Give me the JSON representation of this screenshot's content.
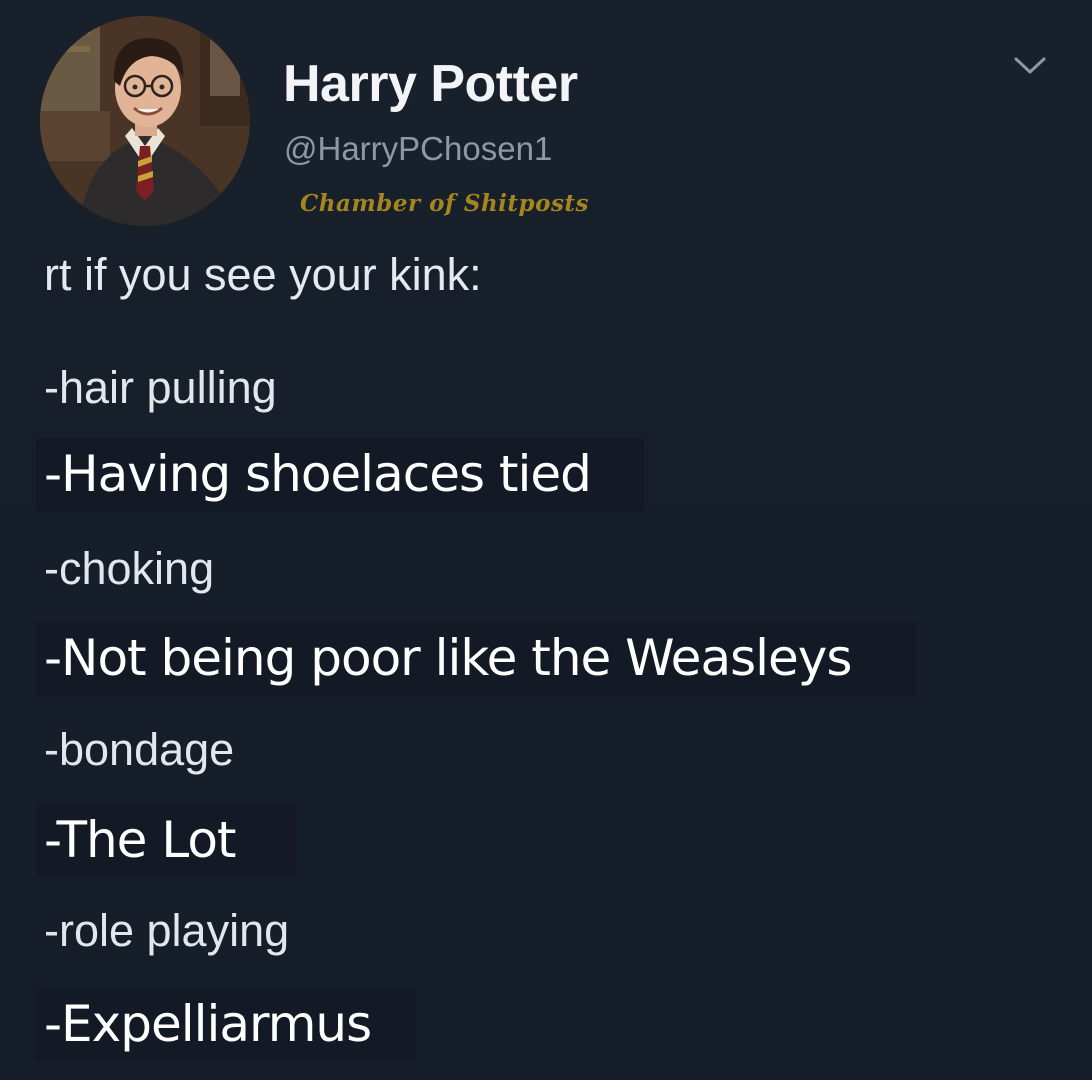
{
  "tweet": {
    "display_name": "Harry Potter",
    "handle": "@HarryPChosen1",
    "watermark": "Chamber of Shitposts",
    "menu_icon": "chevron-down-icon",
    "avatar_icon": "profile-photo",
    "text": {
      "intro": "rt if you see your kink:",
      "items": [
        "-hair pulling",
        "-Having shoelaces tied",
        "-choking",
        "-Not being poor like the Weasleys",
        "-bondage",
        "-The Lot",
        "-role playing",
        "-Expelliarmus"
      ]
    }
  },
  "colors": {
    "background": "#151d29",
    "name": "#f2f4f7",
    "handle": "#8d98a6",
    "watermark": "#a5851f",
    "text": "#e6eaef"
  }
}
